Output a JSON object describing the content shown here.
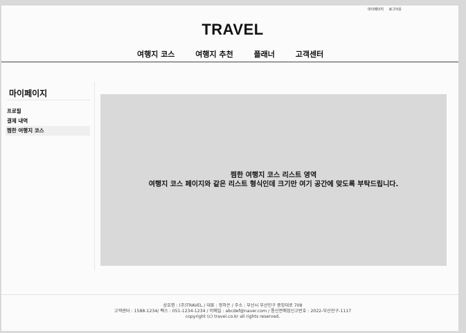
{
  "util_nav": {
    "mypage": "마이페이지",
    "logout": "로그아웃"
  },
  "logo": "TRAVEL",
  "main_nav": [
    "여행지 코스",
    "여행지 추천",
    "플래너",
    "고객센터"
  ],
  "sidebar": {
    "title": "마이페이지",
    "items": [
      "프로필",
      "결제 내역",
      "찜한 여행지 코스"
    ],
    "active_index": 2
  },
  "content": {
    "line1": "찜한 여행지 코스 리스트 영역",
    "line2": "여행지 코스 페이지와 같은 리스트 형식인데 크기만  여기 공간에 맞도록 부탁드립니다."
  },
  "footer": {
    "line1": "상호명 : (주)TRAVEL / 대표 : 정하은 / 주소 : 부산시 부산진구 중앙대로 708",
    "line2": "고객센터 : 1588-1234/ 팩스 : 051-1234-1234 / 이메일 : abcdef@naver.com / 통신판매업신고번호 : 2022-부산진구-1117",
    "line3": "copyright (c) travel.co.kr all rights reserved."
  },
  "colors": {
    "background": "#d9d9d9",
    "page": "#fbfbfb",
    "content_box": "#d9d9d9"
  }
}
